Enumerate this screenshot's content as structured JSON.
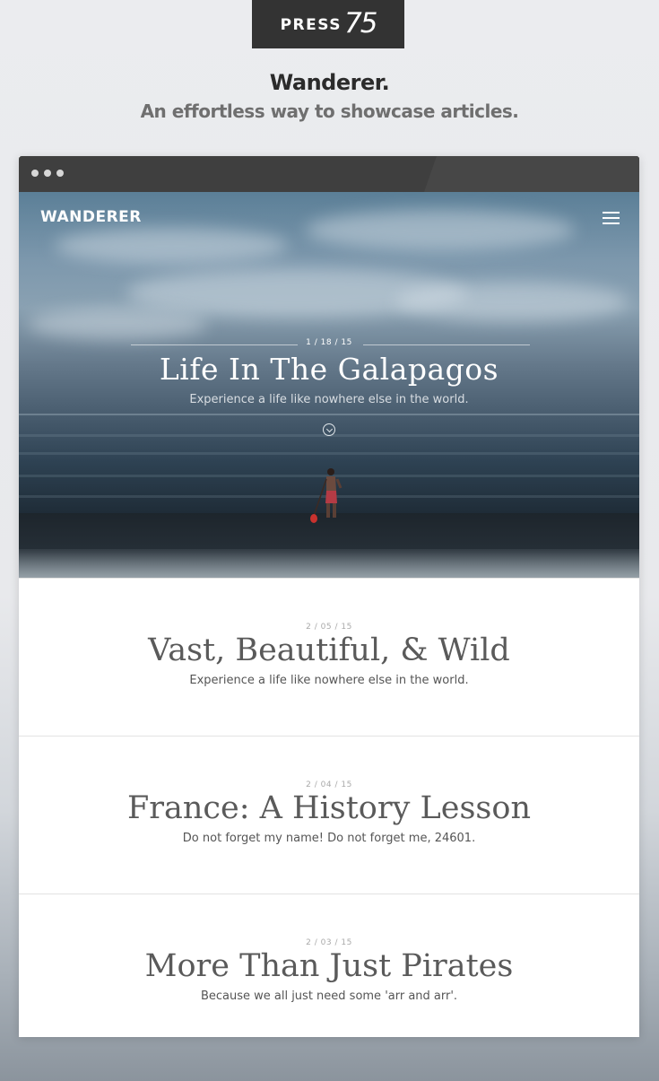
{
  "promo": {
    "badge_word": "PRESS",
    "badge_number": "75",
    "title": "Wanderer.",
    "subtitle": "An effortless way to showcase articles."
  },
  "site": {
    "brand": "WANDERER",
    "menu_icon": "hamburger-menu-icon"
  },
  "hero": {
    "date": "1 / 18 / 15",
    "title": "Life In The Galapagos",
    "subtitle": "Experience a life like nowhere else in the world.",
    "scroll_icon": "chevron-down-circle-icon"
  },
  "articles": [
    {
      "date": "2 / 05 / 15",
      "title": "Vast, Beautiful, & Wild",
      "subtitle": "Experience a life like nowhere else in the world."
    },
    {
      "date": "2 / 04 / 15",
      "title": "France: A History Lesson",
      "subtitle": "Do not forget my name! Do not forget me, 24601."
    },
    {
      "date": "2 / 03 / 15",
      "title": "More Than Just Pirates",
      "subtitle": "Because we all just need some 'arr and arr'."
    }
  ],
  "colors": {
    "badge_bg": "#333333",
    "browser_bar": "#3f3f3f",
    "heading_text": "#5a5a5a"
  }
}
